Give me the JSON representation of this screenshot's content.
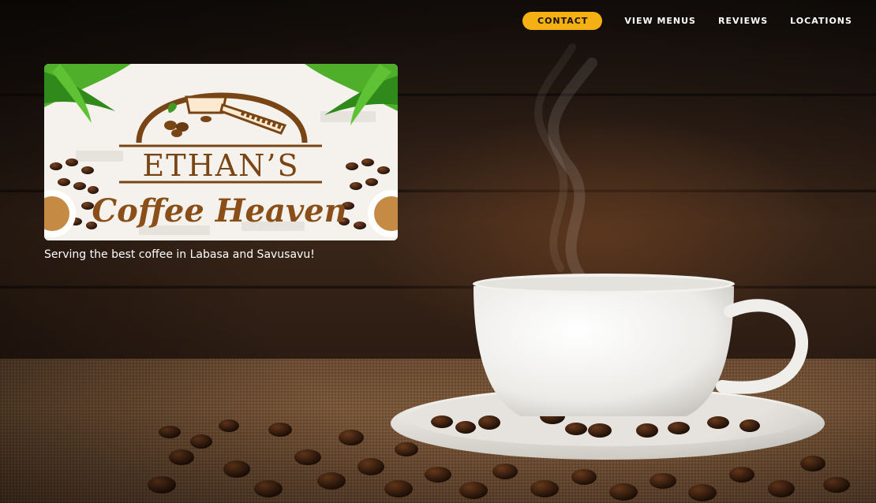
{
  "nav": {
    "contact": "CONTACT",
    "view_menus": "VIEW MENUS",
    "reviews": "REVIEWS",
    "locations": "LOCATIONS"
  },
  "logo": {
    "name_line1": "ETHAN’S",
    "name_line2": "Coffee Heaven"
  },
  "hero": {
    "tagline": "Serving the best coffee in Labasa and Savusavu!"
  },
  "colors": {
    "accent": "#f5b014",
    "logo_brown": "#7a4515",
    "text": "#ffffff"
  },
  "icons": {
    "portafilter": "portafilter-icon",
    "beans": "coffee-bean-icon",
    "palm": "palm-leaf-icon"
  }
}
